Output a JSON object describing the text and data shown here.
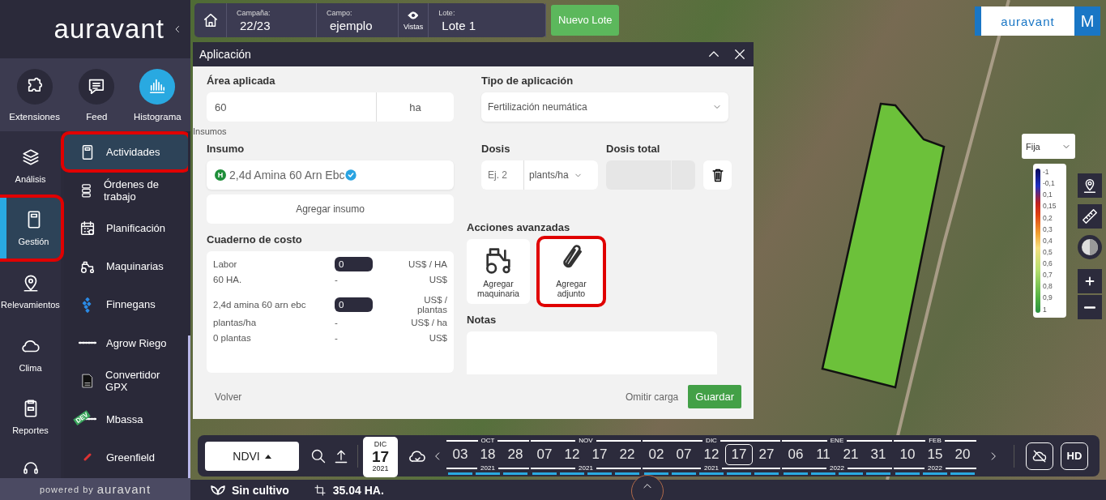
{
  "sidebar": {
    "logo": "auravant",
    "quick_actions": [
      {
        "label": "Extensiones",
        "selected": false
      },
      {
        "label": "Feed",
        "selected": false
      },
      {
        "label": "Histograma",
        "selected": true
      }
    ],
    "nav": [
      {
        "label": "Análisis",
        "selected": false,
        "highlighted": false
      },
      {
        "label": "Gestión",
        "selected": true,
        "highlighted": true
      },
      {
        "label": "Relevamientos",
        "selected": false,
        "highlighted": false
      },
      {
        "label": "Clima",
        "selected": false,
        "highlighted": false
      },
      {
        "label": "Reportes",
        "selected": false,
        "highlighted": false
      }
    ],
    "submenu": [
      {
        "label": "Actividades",
        "selected": true,
        "highlighted": true
      },
      {
        "label": "Órdenes de trabajo",
        "selected": false,
        "highlighted": false
      },
      {
        "label": "Planificación",
        "selected": false,
        "highlighted": false
      },
      {
        "label": "Maquinarias",
        "selected": false,
        "highlighted": false
      },
      {
        "label": "Finnegans",
        "selected": false,
        "highlighted": false
      },
      {
        "label": "Agrow Riego",
        "selected": false,
        "highlighted": false
      },
      {
        "label": "Convertidor GPX",
        "selected": false,
        "highlighted": false
      },
      {
        "label": "Mbassa",
        "selected": false,
        "highlighted": false,
        "tag": "DEV"
      },
      {
        "label": "Greenfield",
        "selected": false,
        "highlighted": false
      }
    ],
    "footer": {
      "prefix": "powered by",
      "brand": "auravant"
    }
  },
  "top_bar": {
    "fields": [
      {
        "label": "Campaña:",
        "value": "22/23"
      },
      {
        "label": "Campo:",
        "value": "ejemplo"
      },
      {
        "label": "Lote:",
        "value": "Lote 1"
      }
    ],
    "views_label": "Vistas",
    "new_button": "Nuevo Lote"
  },
  "modal": {
    "title": "Aplicación",
    "area": {
      "label": "Área aplicada",
      "value": "60",
      "unit": "ha"
    },
    "application_type": {
      "label": "Tipo de aplicación",
      "value": "Fertilización neumática"
    },
    "section": "Insumos",
    "input": {
      "label": "Insumo",
      "badge": "H",
      "value": "2,4d Amina 60 Arn Ebc",
      "verified": true
    },
    "dose": {
      "label": "Dosis",
      "placeholder": "Ej. 2",
      "unit": "plants/ha"
    },
    "total_dose": {
      "label": "Dosis total"
    },
    "add_input": "Agregar insumo",
    "cost": {
      "title": "Cuaderno de costo",
      "rows": [
        {
          "kind": "input",
          "label": "Labor",
          "value": "0",
          "unit": "US$ / HA"
        },
        {
          "kind": "text",
          "label": "60 HA.",
          "value": "-",
          "unit": "US$"
        },
        {
          "kind": "input",
          "label": "2,4d amina 60 arn ebc",
          "value": "0",
          "unit": "US$ / plantas"
        },
        {
          "kind": "text",
          "label": "plantas/ha",
          "value": "-",
          "unit": "US$ / ha"
        },
        {
          "kind": "text",
          "label": "0 plantas",
          "value": "-",
          "unit": "US$"
        }
      ]
    },
    "advanced": {
      "title": "Acciones avanzadas",
      "actions": [
        {
          "label": "Agregar maquinaria",
          "highlighted": false
        },
        {
          "label": "Agregar adjunto",
          "highlighted": true
        }
      ]
    },
    "notes": {
      "label": "Notas"
    },
    "footer": {
      "back": "Volver",
      "skip": "Omitir carga",
      "save": "Guardar"
    }
  },
  "map": {
    "brand": "auravant",
    "avatar": "M",
    "legend": {
      "mode": "Fija",
      "ticks": [
        "-1",
        "-0,1",
        "0,1",
        "0,15",
        "0,2",
        "0,3",
        "0,4",
        "0,5",
        "0,6",
        "0,7",
        "0,8",
        "0,9",
        "1"
      ]
    }
  },
  "timeline": {
    "index": "NDVI",
    "date": {
      "month": "DIC",
      "day": "17",
      "year": "2021"
    },
    "months": [
      {
        "month": "OCT",
        "year": "2021",
        "days": [
          {
            "label": "03",
            "selected": false
          },
          {
            "label": "18",
            "selected": false
          },
          {
            "label": "28",
            "selected": false
          }
        ]
      },
      {
        "month": "NOV",
        "year": "2021",
        "days": [
          {
            "label": "07",
            "selected": false
          },
          {
            "label": "12",
            "selected": false
          },
          {
            "label": "17",
            "selected": false
          },
          {
            "label": "22",
            "selected": false
          }
        ]
      },
      {
        "month": "DIC",
        "year": "2021",
        "days": [
          {
            "label": "02",
            "selected": false
          },
          {
            "label": "07",
            "selected": false
          },
          {
            "label": "12",
            "selected": false
          },
          {
            "label": "17",
            "selected": true
          },
          {
            "label": "27",
            "selected": false
          }
        ]
      },
      {
        "month": "ENE",
        "year": "2022",
        "days": [
          {
            "label": "06",
            "selected": false
          },
          {
            "label": "11",
            "selected": false
          },
          {
            "label": "21",
            "selected": false
          },
          {
            "label": "31",
            "selected": false
          }
        ]
      },
      {
        "month": "FEB",
        "year": "2022",
        "days": [
          {
            "label": "10",
            "selected": false
          },
          {
            "label": "15",
            "selected": false
          },
          {
            "label": "20",
            "selected": false
          }
        ]
      }
    ],
    "hd": "HD"
  },
  "status_bar": {
    "crop": "Sin cultivo",
    "area": "35.04 HA."
  }
}
